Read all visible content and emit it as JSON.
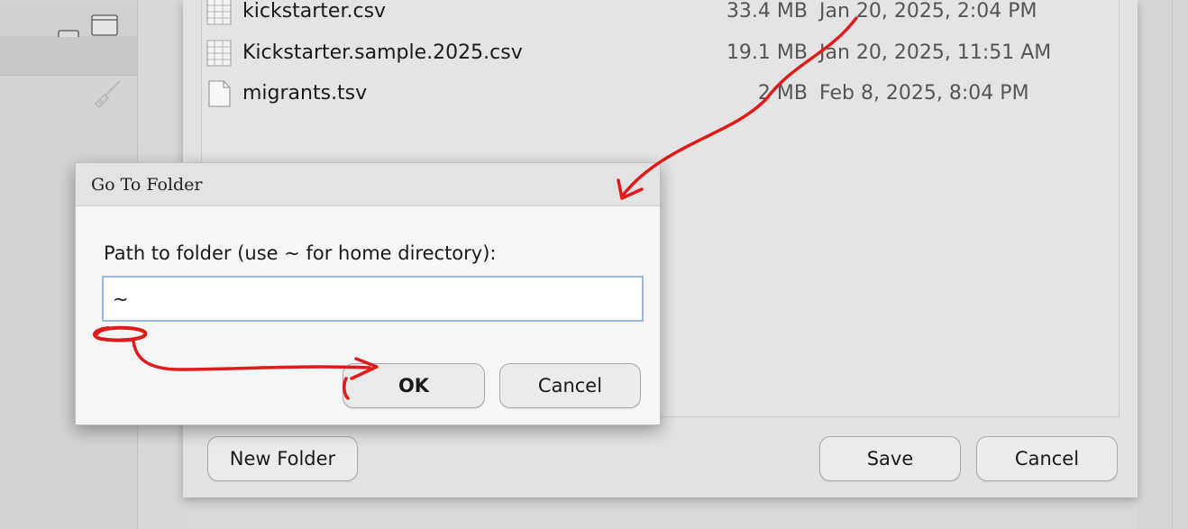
{
  "file_list": [
    {
      "name": "kickstarter.csv",
      "size": "33.4 MB",
      "date": "Jan 20, 2025, 2:04 PM",
      "icon": "spreadsheet-file-icon"
    },
    {
      "name": "Kickstarter.sample.2025.csv",
      "size": "19.1 MB",
      "date": "Jan 20, 2025, 11:51 AM",
      "icon": "spreadsheet-file-icon"
    },
    {
      "name": "migrants.tsv",
      "size": "2 MB",
      "date": "Feb 8, 2025, 8:04 PM",
      "icon": "text-file-icon"
    }
  ],
  "save_dialog": {
    "new_folder_label": "New Folder",
    "save_label": "Save",
    "cancel_label": "Cancel"
  },
  "goto_dialog": {
    "title": "Go To Folder",
    "prompt": "Path to folder (use ~ for home directory):",
    "path_value": "~",
    "ok_label": "OK",
    "cancel_label": "Cancel"
  },
  "left_pane_icons": [
    "minimize-icon",
    "maximize-icon",
    "broom-icon"
  ],
  "colors": {
    "annotation": "#e01b1b",
    "input_focus_border": "#97b8e2"
  }
}
